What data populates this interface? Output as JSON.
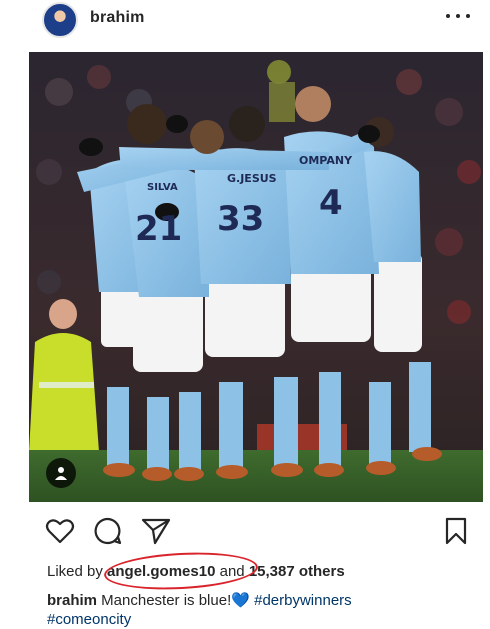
{
  "post": {
    "username": "brahim",
    "avatar_icon": "profile-avatar",
    "more_icon": "more-options-icon"
  },
  "image": {
    "description_icon": "football-team-celebration-photo",
    "jersey_names": [
      "SILVA",
      "G.JESUS",
      "OMPANY"
    ],
    "jersey_numbers": [
      "21",
      "33",
      "4"
    ]
  },
  "actions": {
    "like_icon": "heart-icon",
    "comment_icon": "comment-icon",
    "share_icon": "send-icon",
    "save_icon": "bookmark-icon"
  },
  "likes": {
    "prefix": "Liked by ",
    "user": "angel.gomes10",
    "middle": " and ",
    "count": "15,387 others"
  },
  "caption": {
    "username": "brahim",
    "text": " Manchester is blue!",
    "emoji": "💙",
    "hashtag1": "#derbywinners",
    "hashtag2": "#comeoncity"
  },
  "colors": {
    "annotation_red": "#d9242b",
    "city_blue": "#8ec1e6",
    "hashtag_blue": "#003569",
    "heart_blue": "#3c8ce7"
  }
}
